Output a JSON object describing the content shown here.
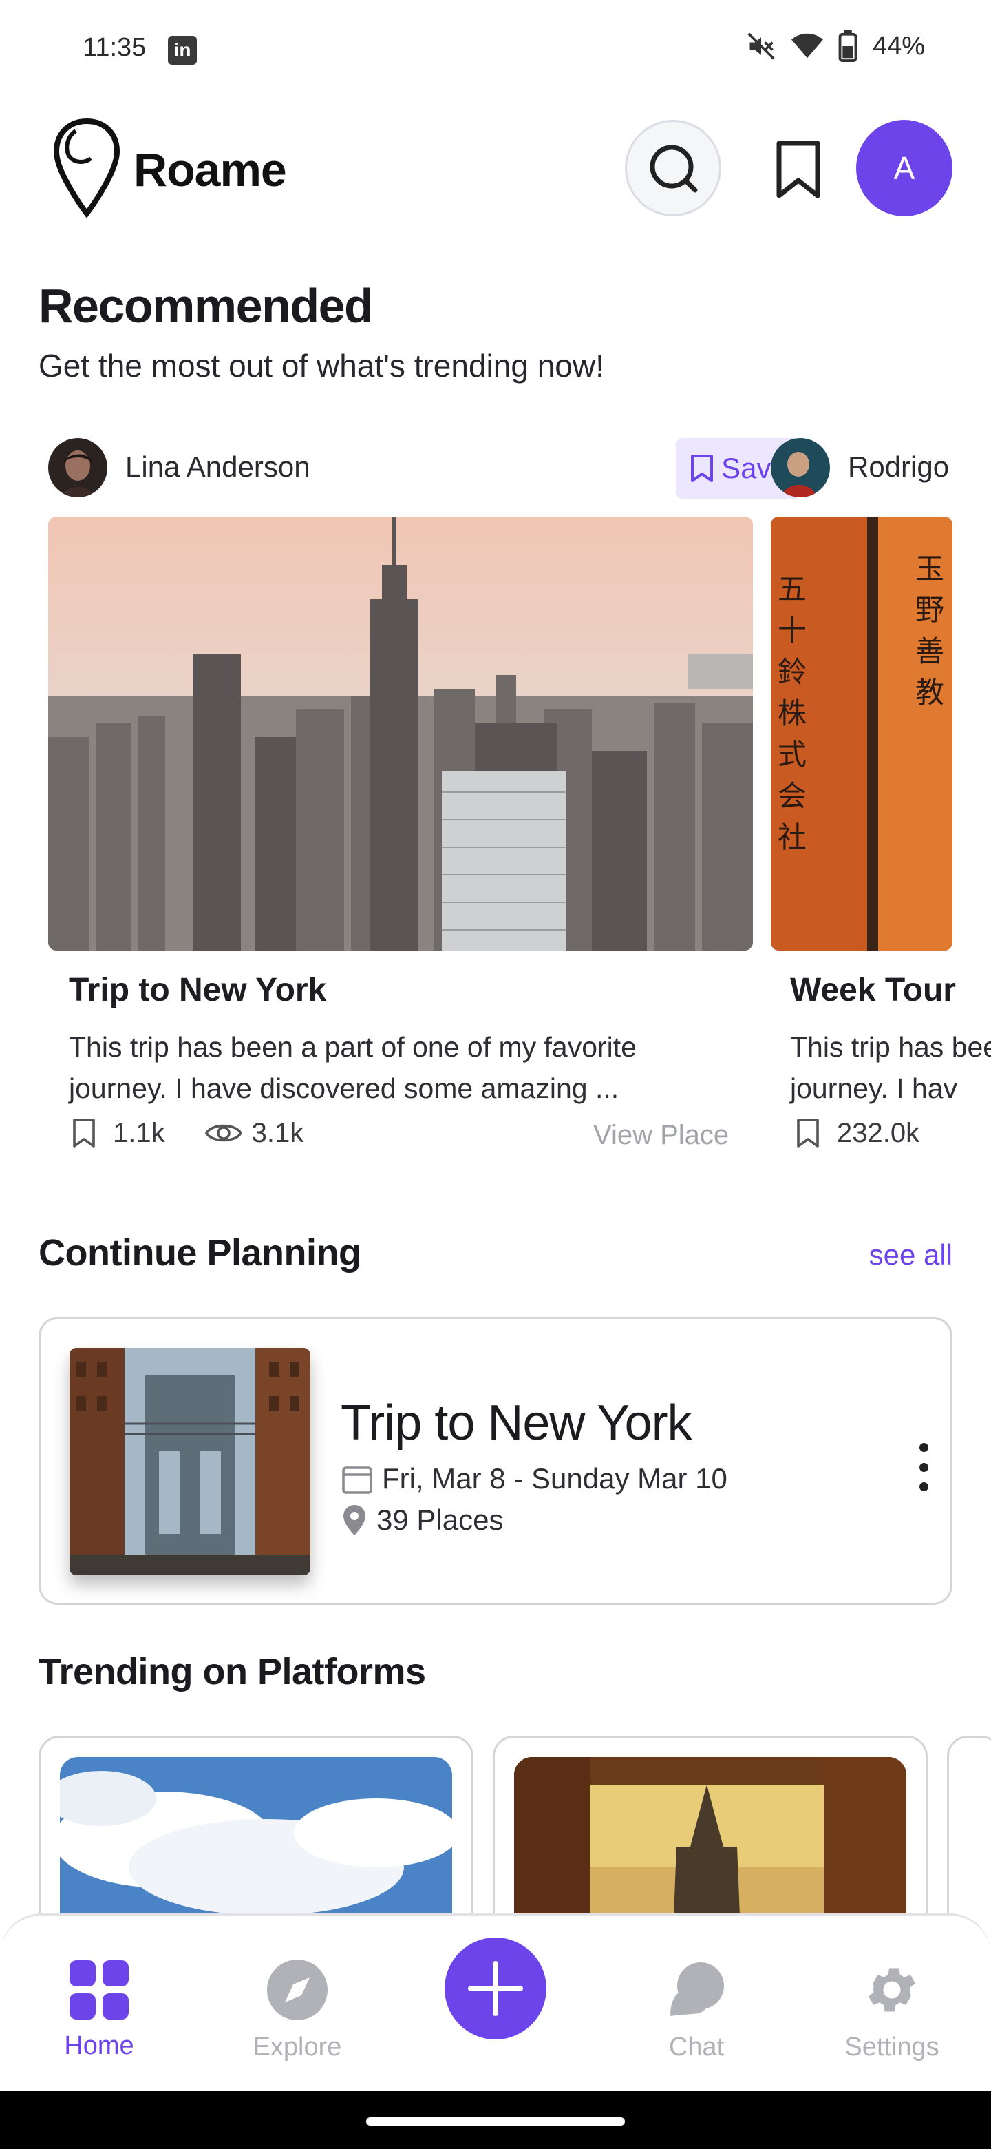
{
  "status_bar": {
    "time": "11:35",
    "notif_icon": "linkedin-icon",
    "battery": "44%"
  },
  "header": {
    "app_name": "Roame",
    "avatar_initial": "A"
  },
  "recommended": {
    "title": "Recommended",
    "subtitle": "Get the most out of what's trending now!",
    "cards": [
      {
        "author": "Lina Anderson",
        "save_label": "Save",
        "title": "Trip to New York",
        "description": "This trip has been a part of one of my favorite journey. I have discovered some amazing ...",
        "saves": "1.1k",
        "views": "3.1k",
        "view_label": "View Place"
      },
      {
        "author": "Rodrigo",
        "title": "Week Tour",
        "description": "This trip has been a part of one of my favorite journey. I hav",
        "saves": "232.0k"
      }
    ]
  },
  "continue_planning": {
    "title": "Continue Planning",
    "see_all": "see all",
    "trip": {
      "title": "Trip to New York",
      "dates": "Fri, Mar 8 - Sunday Mar 10",
      "places": "39 Places"
    }
  },
  "trending": {
    "title": "Trending on Platforms"
  },
  "nav": {
    "home": "Home",
    "explore": "Explore",
    "chat": "Chat",
    "settings": "Settings"
  },
  "colors": {
    "accent": "#6d44ea",
    "muted": "#b1b1b8",
    "save_bg": "#ece7ff"
  }
}
